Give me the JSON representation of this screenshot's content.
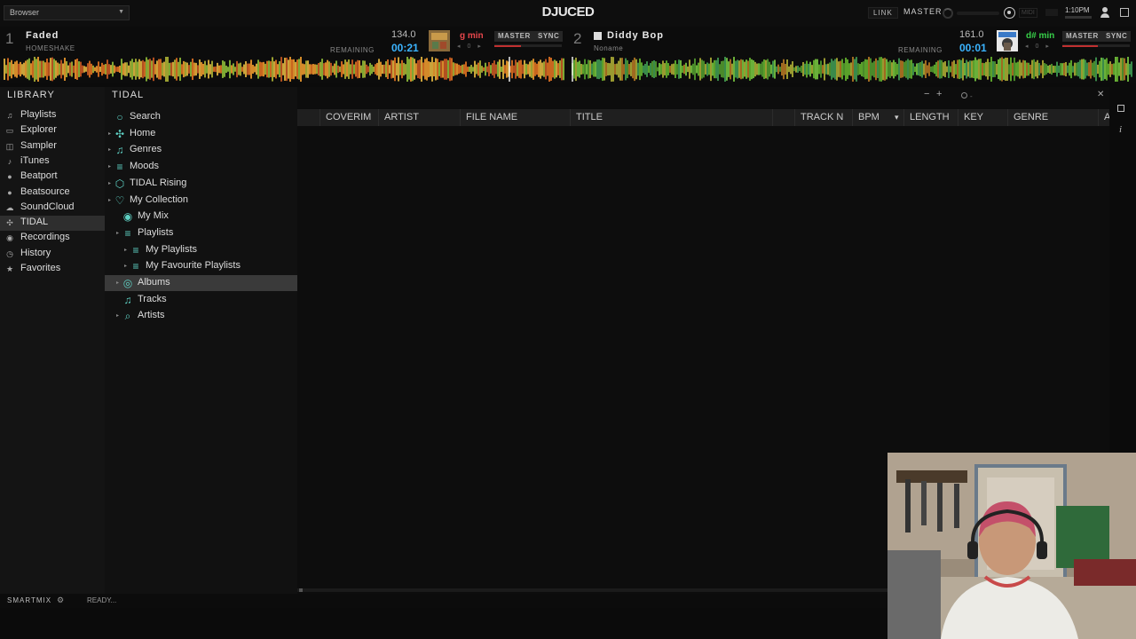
{
  "topbar": {
    "browser_select": "Browser",
    "logo": "DJUCED",
    "link": "LINK",
    "master": "MASTER",
    "midi": "MIDI",
    "clock": "1:10PM"
  },
  "deck1": {
    "number": "1",
    "title": "Faded",
    "artist": "HOMESHAKE",
    "remaining_label": "REMAINING",
    "bpm": "134.0",
    "time": "00:21",
    "key": "g min",
    "key_color": "#e8474c",
    "master_btn": "MASTER",
    "sync_btn": "SYNC",
    "pitch": "0"
  },
  "deck2": {
    "number": "2",
    "title": "Diddy Bop",
    "artist": "Noname",
    "remaining_label": "REMAINING",
    "bpm": "161.0",
    "time": "00:01",
    "key": "d# min",
    "key_color": "#38d14a",
    "master_btn": "MASTER",
    "sync_btn": "SYNC",
    "pitch": "0"
  },
  "library": {
    "header": "LIBRARY",
    "items": [
      {
        "label": "Playlists",
        "icon": "playlist-icon"
      },
      {
        "label": "Explorer",
        "icon": "folder-icon"
      },
      {
        "label": "Sampler",
        "icon": "sampler-icon"
      },
      {
        "label": "iTunes",
        "icon": "itunes-icon"
      },
      {
        "label": "Beatport",
        "icon": "beatport-icon"
      },
      {
        "label": "Beatsource",
        "icon": "beatsource-icon"
      },
      {
        "label": "SoundCloud",
        "icon": "soundcloud-icon"
      },
      {
        "label": "TIDAL",
        "icon": "tidal-icon"
      },
      {
        "label": "Recordings",
        "icon": "record-icon"
      },
      {
        "label": "History",
        "icon": "history-icon"
      },
      {
        "label": "Favorites",
        "icon": "star-icon"
      }
    ],
    "active": "TIDAL"
  },
  "tidal": {
    "header": "TIDAL",
    "tree": [
      {
        "label": "Search",
        "icon": "search-icon"
      },
      {
        "label": "Home",
        "icon": "tidal-icon"
      },
      {
        "label": "Genres",
        "icon": "music-note-icon"
      },
      {
        "label": "Moods",
        "icon": "playlist-icon"
      },
      {
        "label": "TIDAL Rising",
        "icon": "rising-icon"
      },
      {
        "label": "My Collection",
        "icon": "heart-icon"
      },
      {
        "label": "My Mix",
        "icon": "radio-icon"
      },
      {
        "label": "Playlists",
        "icon": "playlist-icon"
      },
      {
        "label": "My Playlists",
        "icon": "playlist-icon"
      },
      {
        "label": "My Favourite Playlists",
        "icon": "playlist-icon"
      },
      {
        "label": "Albums",
        "icon": "album-icon"
      },
      {
        "label": "Tracks",
        "icon": "music-note-icon"
      },
      {
        "label": "Artists",
        "icon": "microphone-icon"
      }
    ],
    "selected": "Albums"
  },
  "table": {
    "columns": [
      "COVERIM",
      "ARTIST",
      "FILE NAME",
      "TITLE",
      "",
      "TRACK N",
      "BPM",
      "LENGTH",
      "KEY",
      "GENRE",
      "A"
    ],
    "search_placeholder": "-"
  },
  "statusbar": {
    "smartmix": "SMARTMIX",
    "status": "READY..."
  }
}
